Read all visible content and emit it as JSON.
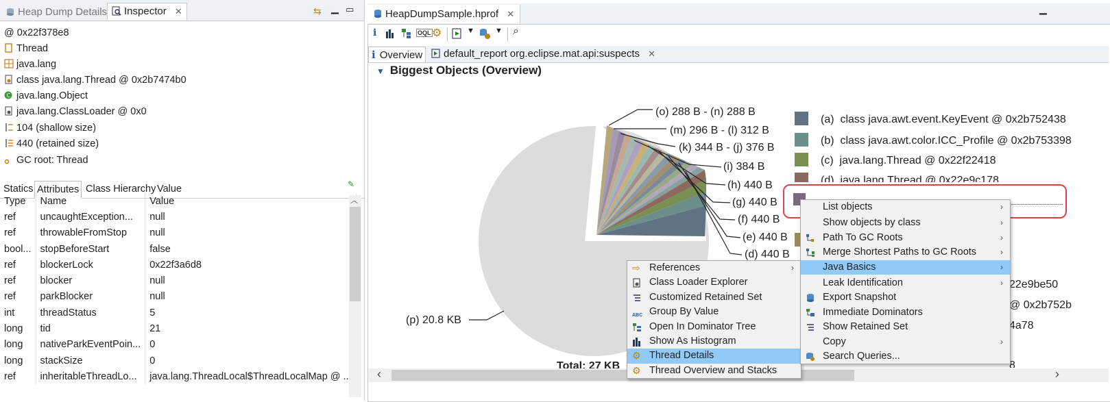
{
  "left_panel": {
    "tabs": [
      {
        "label": "Heap Dump Details",
        "active": false,
        "icon": "heap-dump-icon"
      },
      {
        "label": "Inspector",
        "active": true,
        "icon": "inspector-icon"
      }
    ],
    "properties": [
      {
        "icon": "address-at-icon",
        "text": "0x22f378e8",
        "prefix": "@"
      },
      {
        "icon": "class-icon",
        "text": "Thread"
      },
      {
        "icon": "package-icon",
        "text": "java.lang"
      },
      {
        "icon": "class-file-icon",
        "text": "class java.lang.Thread @ 0x2b7474b0"
      },
      {
        "icon": "superclass-icon",
        "text": "java.lang.Object"
      },
      {
        "icon": "classloader-icon",
        "text": "java.lang.ClassLoader @ 0x0"
      },
      {
        "icon": "shallow-size-icon",
        "text": "104 (shallow size)"
      },
      {
        "icon": "retained-size-icon",
        "text": "440 (retained size)"
      },
      {
        "icon": "gc-root-icon",
        "text": "GC root: Thread"
      }
    ],
    "attr_tabs": [
      "Statics",
      "Attributes",
      "Class Hierarchy",
      "Value"
    ],
    "attr_active": "Attributes",
    "table": {
      "headers": [
        "Type",
        "Name",
        "Value"
      ],
      "rows": [
        [
          "ref",
          "uncaughtException...",
          "null"
        ],
        [
          "ref",
          "throwableFromStop",
          "null"
        ],
        [
          "bool...",
          "stopBeforeStart",
          "false"
        ],
        [
          "ref",
          "blockerLock",
          "0x22f3a6d8"
        ],
        [
          "ref",
          "blocker",
          "null"
        ],
        [
          "ref",
          "parkBlocker",
          "null"
        ],
        [
          "int",
          "threadStatus",
          "5"
        ],
        [
          "long",
          "tid",
          "21"
        ],
        [
          "long",
          "nativeParkEventPoin...",
          "0"
        ],
        [
          "long",
          "stackSize",
          "0"
        ],
        [
          "ref",
          "inheritableThreadLo...",
          "java.lang.ThreadLocal$ThreadLocalMap @ ..."
        ]
      ]
    }
  },
  "right_panel": {
    "editor_tab": "HeapDumpSample.hprof",
    "subtabs": [
      "Overview",
      "default_report  org.eclipse.mat.api:suspects"
    ],
    "section_title": "Biggest Objects (Overview)",
    "pie_labels": [
      "(o)  288 B - (n)  288 B",
      "(m)  296 B - (l)  312 B",
      "(k)  344 B - (j)  376 B",
      "(i)  384 B",
      "(h)  440 B",
      "(g)  440 B",
      "(f)  440 B",
      "(e)  440 B",
      "(d)  440 B",
      "(p)  20.8 KB"
    ],
    "total_label": "Total: 27 KB",
    "legend": [
      {
        "key": "(a)",
        "text": "class java.awt.event.KeyEvent @ 0x2b752438",
        "color": "#5f7382"
      },
      {
        "key": "(b)",
        "text": "class java.awt.color.ICC_Profile @ 0x2b753398",
        "color": "#6c8f8c"
      },
      {
        "key": "(c)",
        "text": "java.lang.Thread @ 0x22f22418",
        "color": "#7a8f52"
      },
      {
        "key": "(d)",
        "text": "java.lang.Thread @ 0x22e9c178",
        "color": "#8a6a5e"
      }
    ],
    "legend_partial": [
      "22e9be50",
      "@ 0x2b752b",
      "4a78",
      "8"
    ]
  },
  "context_menu": {
    "items": [
      {
        "label": "List objects",
        "icon": "",
        "submenu": true
      },
      {
        "label": "Show objects by class",
        "icon": "",
        "submenu": true
      },
      {
        "label": "Path To GC Roots",
        "icon": "path-icon",
        "submenu": true
      },
      {
        "label": "Merge Shortest Paths to GC Roots",
        "icon": "merge-paths-icon",
        "submenu": true
      },
      {
        "label": "Java Basics",
        "icon": "",
        "submenu": true,
        "selected": true
      },
      {
        "label": "Leak Identification",
        "icon": "",
        "submenu": true
      },
      {
        "label": "Export Snapshot",
        "icon": "export-icon",
        "submenu": false
      },
      {
        "label": "Immediate Dominators",
        "icon": "dominators-icon",
        "submenu": false
      },
      {
        "label": "Show Retained Set",
        "icon": "retained-set-icon",
        "submenu": false
      },
      {
        "label": "Copy",
        "icon": "",
        "submenu": true
      },
      {
        "label": "Search Queries...",
        "icon": "search-queries-icon",
        "submenu": false
      }
    ]
  },
  "submenu": {
    "items": [
      {
        "label": "References",
        "icon": "references-icon",
        "submenu": true
      },
      {
        "label": "Class Loader Explorer",
        "icon": "classloader-explorer-icon",
        "submenu": false
      },
      {
        "label": "Customized Retained Set",
        "icon": "retained-set-icon",
        "submenu": false
      },
      {
        "label": "Group By Value",
        "icon": "group-by-value-icon",
        "submenu": false
      },
      {
        "label": "Open In Dominator Tree",
        "icon": "dominator-tree-icon",
        "submenu": false
      },
      {
        "label": "Show As Histogram",
        "icon": "histogram-icon",
        "submenu": false
      },
      {
        "label": "Thread Details",
        "icon": "thread-details-icon",
        "submenu": false,
        "selected": true
      },
      {
        "label": "Thread Overview and Stacks",
        "icon": "thread-stacks-icon",
        "submenu": false
      }
    ]
  },
  "colors": {
    "selection": "#91c9f7",
    "highlight": "#e0404c",
    "pie_bg": "#dcdcdc"
  }
}
